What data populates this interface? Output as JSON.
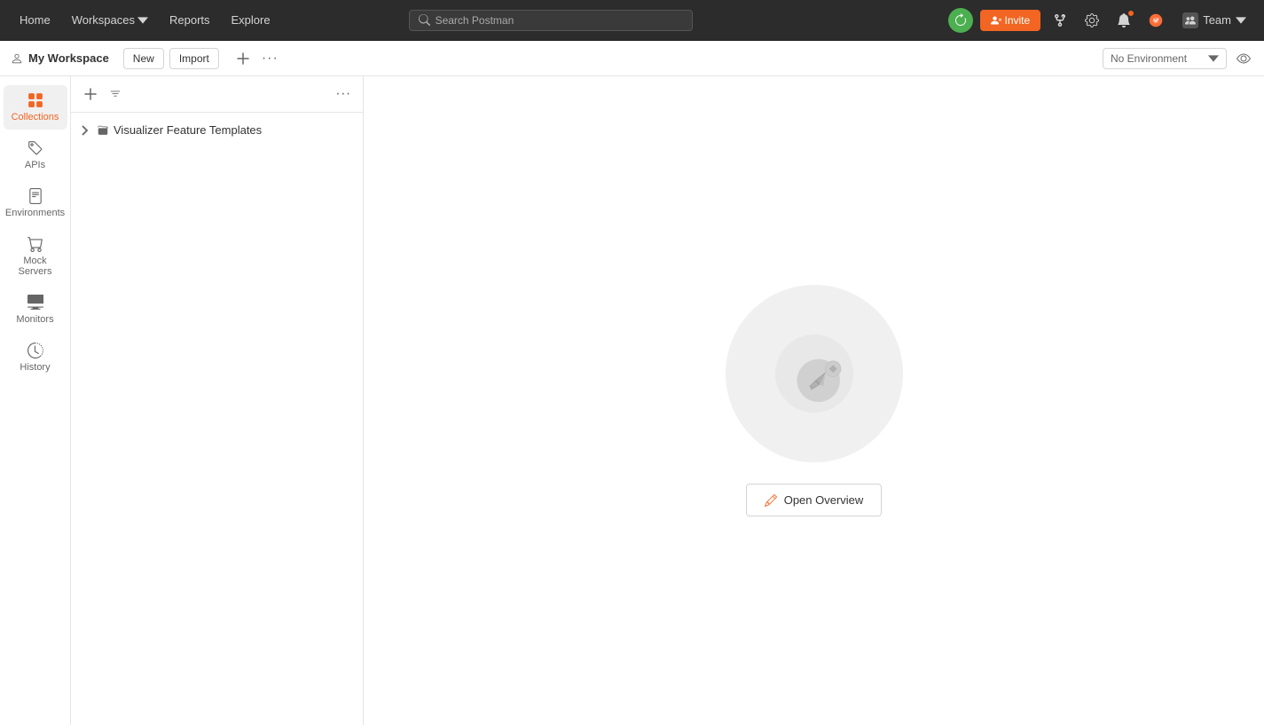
{
  "topNav": {
    "home_label": "Home",
    "workspaces_label": "Workspaces",
    "reports_label": "Reports",
    "explore_label": "Explore",
    "search_placeholder": "Search Postman",
    "invite_label": "Invite",
    "team_label": "Team"
  },
  "workspaceBar": {
    "workspace_name": "My Workspace",
    "new_label": "New",
    "import_label": "Import",
    "env_selector_label": "No Environment"
  },
  "sidebar": {
    "items": [
      {
        "id": "collections",
        "label": "Collections",
        "active": true
      },
      {
        "id": "apis",
        "label": "APIs",
        "active": false
      },
      {
        "id": "environments",
        "label": "Environments",
        "active": false
      },
      {
        "id": "mock-servers",
        "label": "Mock Servers",
        "active": false
      },
      {
        "id": "monitors",
        "label": "Monitors",
        "active": false
      },
      {
        "id": "history",
        "label": "History",
        "active": false
      }
    ]
  },
  "collectionsPanel": {
    "collection_item": "Visualizer Feature Templates"
  },
  "mainContent": {
    "open_overview_label": "Open Overview"
  }
}
